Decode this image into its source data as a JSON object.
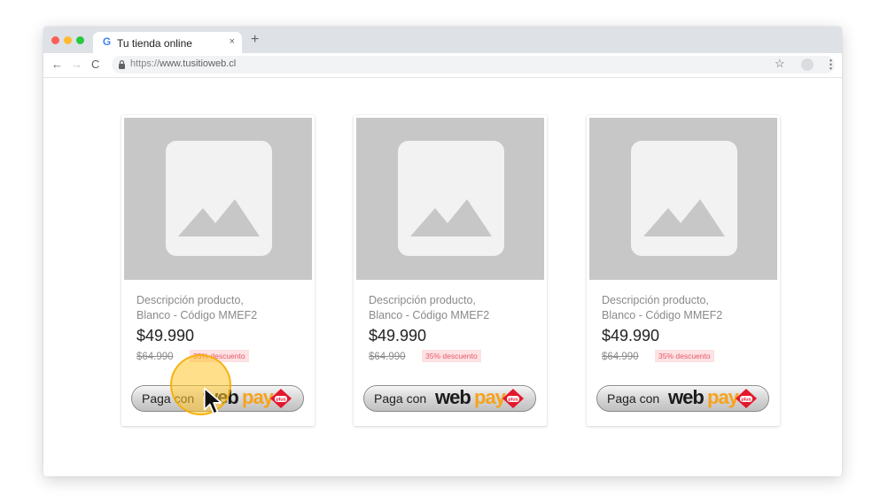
{
  "browser": {
    "tab_title": "Tu tienda online",
    "tab_favicon": "G",
    "tab_close": "×",
    "new_tab": "+",
    "url_scheme": "https://",
    "url_host": "www.tusitioweb.cl",
    "nav_back": "←",
    "nav_forward": "→",
    "nav_reload": "C",
    "star": "☆",
    "menu": "⋮"
  },
  "products": [
    {
      "description_line1": "Descripción producto,",
      "description_line2": "Blanco - Código MMEF2",
      "price": "$49.990",
      "old_price": "$64.990",
      "discount": "35% descuento",
      "button_text": "Paga con",
      "logo_web": "web",
      "logo_pay": "pay",
      "logo_plus": "plus"
    },
    {
      "description_line1": "Descripción producto,",
      "description_line2": "Blanco - Código MMEF2",
      "price": "$49.990",
      "old_price": "$64.990",
      "discount": "35% descuento",
      "button_text": "Paga con",
      "logo_web": "web",
      "logo_pay": "pay",
      "logo_plus": "plus"
    },
    {
      "description_line1": "Descripción producto,",
      "description_line2": "Blanco - Código MMEF2",
      "price": "$49.990",
      "old_price": "$64.990",
      "discount": "35% descuento",
      "button_text": "Paga con",
      "logo_web": "web",
      "logo_pay": "pay",
      "logo_plus": "plus"
    }
  ],
  "colors": {
    "webpay_orange": "#f7a21b",
    "webpay_red": "#e3182d",
    "discount_bg": "#fde1e3",
    "discount_text": "#e55b6a",
    "placeholder_bg": "#c7c7c7"
  },
  "icons": [
    "google-favicon-icon",
    "lock-icon",
    "star-icon",
    "profile-icon",
    "menu-icon",
    "image-placeholder-icon",
    "cursor-arrow-icon"
  ]
}
